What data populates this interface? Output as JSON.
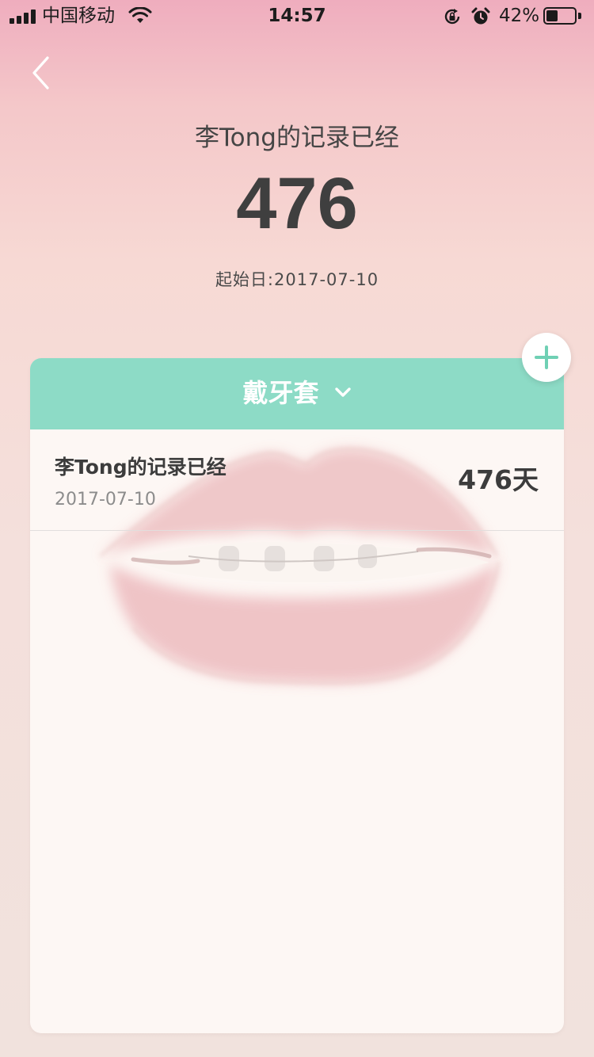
{
  "status_bar": {
    "carrier": "中国移动",
    "time": "14:57",
    "battery_percent": "42%",
    "battery_level": 0.42
  },
  "header": {
    "title": "李Tong的记录已经",
    "count": "476",
    "start_date": "起始日:2017-07-10"
  },
  "card": {
    "category_label": "戴牙套",
    "records": [
      {
        "title": "李Tong的记录已经",
        "date": "2017-07-10",
        "days": "476天"
      }
    ]
  },
  "colors": {
    "accent": "#8ddbc6",
    "plus": "#6fd0b4",
    "text_dark": "#3c3c3c"
  },
  "icons": [
    "signal-icon",
    "wifi-icon",
    "rotation-lock-icon",
    "alarm-icon",
    "battery-icon",
    "back-chevron-icon",
    "chevron-down-icon",
    "plus-icon"
  ]
}
